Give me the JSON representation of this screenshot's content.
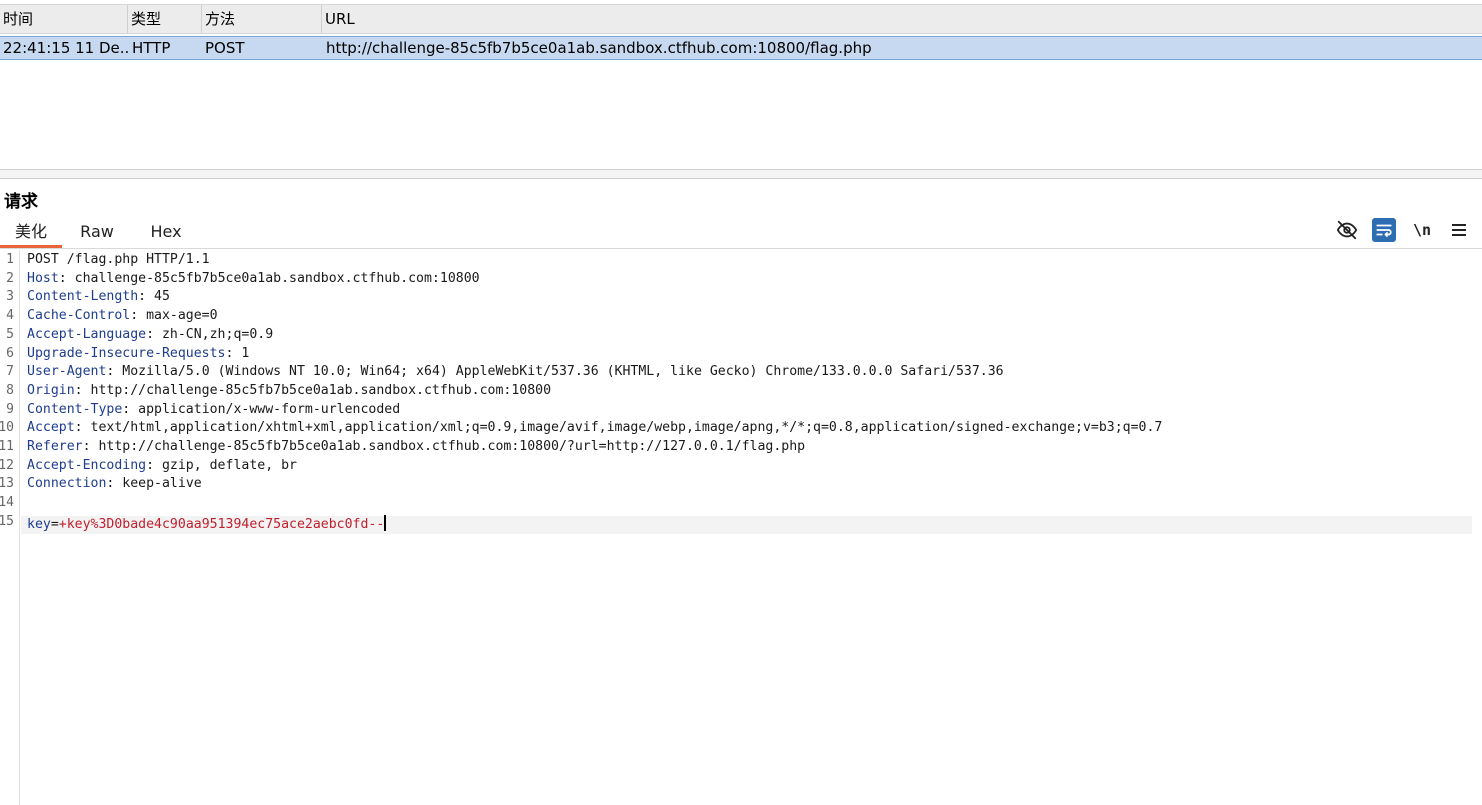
{
  "history": {
    "columns": [
      "时间",
      "类型",
      "方法",
      "URL"
    ],
    "rows": [
      {
        "time": "22:41:15 11 De...",
        "type": "HTTP",
        "method": "POST",
        "url": "http://challenge-85c5fb7b5ce0a1ab.sandbox.ctfhub.com:10800/flag.php"
      }
    ]
  },
  "request": {
    "title": "请求",
    "tabs": [
      "美化",
      "Raw",
      "Hex"
    ],
    "active_tab": "美化",
    "toolbar": {
      "icons": [
        "eye-slash-icon",
        "wrap-text-icon",
        "newline-icon",
        "menu-icon"
      ],
      "newline_label": "\\n"
    },
    "line_numbers": [
      "1",
      "2",
      "3",
      "4",
      "5",
      "6",
      "7",
      "8",
      "9",
      "10",
      "11",
      "12",
      "13",
      "14",
      "15"
    ],
    "request_line": "POST /flag.php HTTP/1.1",
    "headers": [
      {
        "name": "Host",
        "value": "challenge-85c5fb7b5ce0a1ab.sandbox.ctfhub.com:10800"
      },
      {
        "name": "Content-Length",
        "value": "45"
      },
      {
        "name": "Cache-Control",
        "value": "max-age=0"
      },
      {
        "name": "Accept-Language",
        "value": "zh-CN,zh;q=0.9"
      },
      {
        "name": "Upgrade-Insecure-Requests",
        "value": "1"
      },
      {
        "name": "User-Agent",
        "value": "Mozilla/5.0 (Windows NT 10.0; Win64; x64) AppleWebKit/537.36 (KHTML, like Gecko) Chrome/133.0.0.0 Safari/537.36"
      },
      {
        "name": "Origin",
        "value": "http://challenge-85c5fb7b5ce0a1ab.sandbox.ctfhub.com:10800"
      },
      {
        "name": "Content-Type",
        "value": "application/x-www-form-urlencoded"
      },
      {
        "name": "Accept",
        "value": "text/html,application/xhtml+xml,application/xml;q=0.9,image/avif,image/webp,image/apng,*/*;q=0.8,application/signed-exchange;v=b3;q=0.7"
      },
      {
        "name": "Referer",
        "value": "http://challenge-85c5fb7b5ce0a1ab.sandbox.ctfhub.com:10800/?url=http://127.0.0.1/flag.php"
      },
      {
        "name": "Accept-Encoding",
        "value": "gzip, deflate, br"
      },
      {
        "name": "Connection",
        "value": "keep-alive"
      }
    ],
    "body": {
      "param_name": "key",
      "param_value": "+key%3D0bade4c90aa951394ec75ace2aebc0fd--"
    }
  },
  "colors": {
    "header_name": "#1f3d8f",
    "param_value": "#c01f2c",
    "selected_row": "#c7d9f0",
    "active_tab_underline": "#e8663a",
    "wrap_button": "#2f6db3"
  }
}
